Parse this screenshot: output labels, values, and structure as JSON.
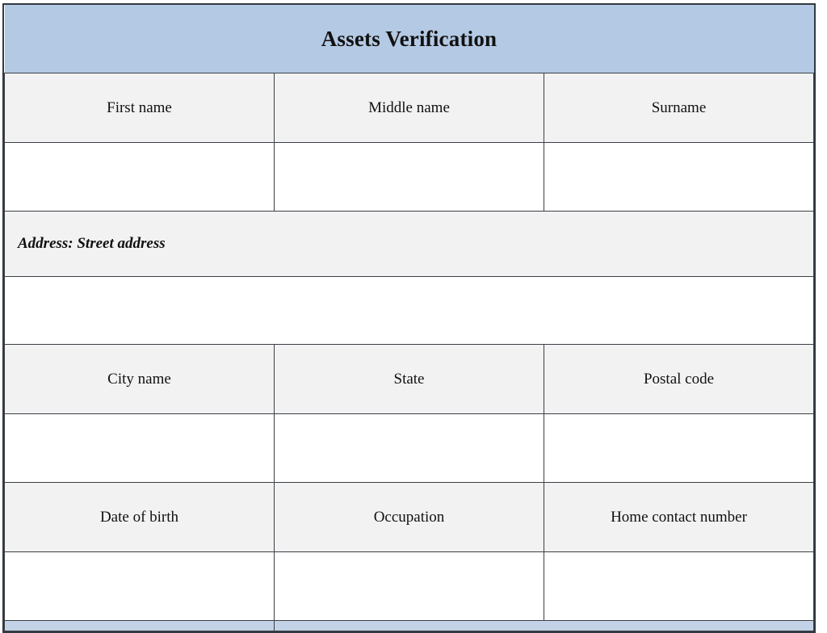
{
  "document": {
    "title": "Assets Verification",
    "theme": {
      "banner_color": "#b4c9e3",
      "label_row_color": "#f2f2f2",
      "entry_row_color": "#ffffff",
      "border_color": "#3a4047",
      "text_color": "#111111"
    }
  },
  "rows": {
    "name_labels": {
      "first_name": "First name",
      "middle_name": "Middle name",
      "surname": "Surname"
    },
    "name_values": {
      "first_name": "",
      "middle_name": "",
      "surname": ""
    },
    "address_label": "Address: Street address",
    "address_value": "",
    "location_labels": {
      "city": "City name",
      "state": "State",
      "postal_code": "Postal code"
    },
    "location_values": {
      "city": "",
      "state": "",
      "postal_code": ""
    },
    "personal_labels": {
      "date_of_birth": "Date of birth",
      "occupation": "Occupation",
      "home_contact_number": "Home contact number"
    },
    "personal_values": {
      "date_of_birth": "",
      "occupation": "",
      "home_contact_number": ""
    }
  }
}
